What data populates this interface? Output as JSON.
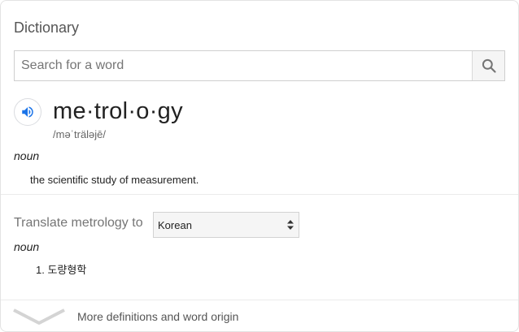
{
  "card": {
    "title": "Dictionary"
  },
  "search": {
    "placeholder": "Search for a word",
    "value": ""
  },
  "entry": {
    "headword": "me·trol·o·gy",
    "pronunciation": "/məˈträləjē/",
    "part_of_speech": "noun",
    "definition": "the scientific study of measurement."
  },
  "translate": {
    "label": "Translate metrology to",
    "selected_language": "Korean",
    "part_of_speech": "noun",
    "items": [
      "1. 도량형학"
    ]
  },
  "more": {
    "label": "More definitions and word origin"
  },
  "icons": {
    "search": "search-icon",
    "speaker": "speaker-icon",
    "select_arrows": "select-arrows-icon",
    "chevron": "chevron-down-icon"
  },
  "colors": {
    "accent": "#1a73e8",
    "icon_gray": "#757575"
  }
}
